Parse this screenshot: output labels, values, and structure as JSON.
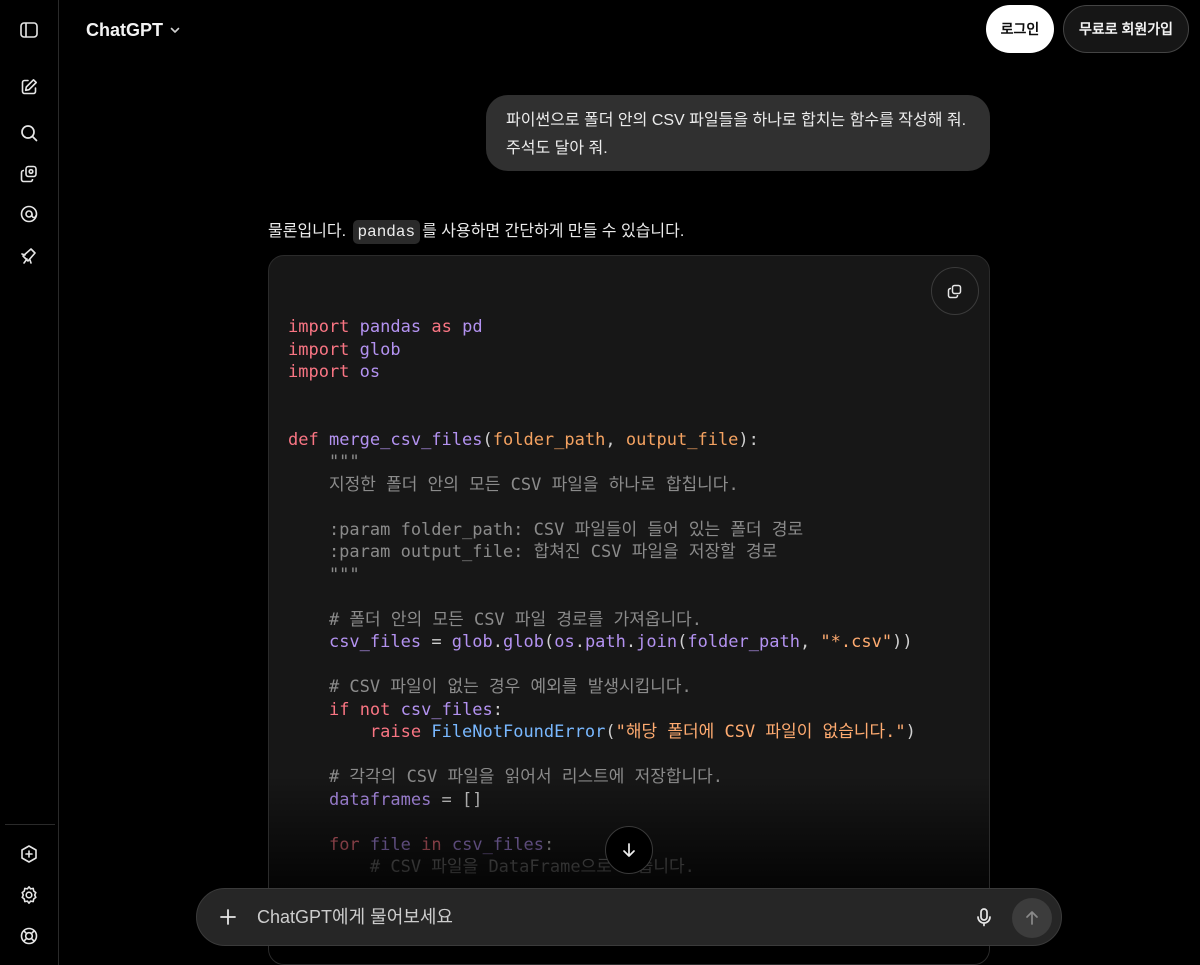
{
  "sidebar": {
    "icons": [
      "sidebar-toggle-icon",
      "new-chat-icon",
      "search-icon",
      "library-icon",
      "sora-icon",
      "gpts-icon",
      "upgrade-icon",
      "settings-icon",
      "help-icon"
    ]
  },
  "header": {
    "model_label": "ChatGPT",
    "login_label": "로그인",
    "signup_label": "무료로 회원가입"
  },
  "conversation": {
    "user_message": "파이썬으로 폴더 안의 CSV 파일들을 하나로 합치는 함수를 작성해 줘. 주석도 달아 줘.",
    "assistant_intro_before": "물론입니다.",
    "assistant_inline_code": "pandas",
    "assistant_intro_after": "를 사용하면 간단하게 만들 수 있습니다."
  },
  "code_block": {
    "lines": [
      "import pandas as pd",
      "import glob",
      "import os",
      "",
      "",
      "def merge_csv_files(folder_path, output_file):",
      "    \"\"\"",
      "    지정한 폴더 안의 모든 CSV 파일을 하나로 합칩니다.",
      "",
      "    :param folder_path: CSV 파일들이 들어 있는 폴더 경로",
      "    :param output_file: 합쳐진 CSV 파일을 저장할 경로",
      "    \"\"\"",
      "",
      "    # 폴더 안의 모든 CSV 파일 경로를 가져옵니다.",
      "    csv_files = glob.glob(os.path.join(folder_path, \"*.csv\"))",
      "",
      "    # CSV 파일이 없는 경우 예외를 발생시킵니다.",
      "    if not csv_files:",
      "        raise FileNotFoundError(\"해당 폴더에 CSV 파일이 없습니다.\")",
      "",
      "    # 각각의 CSV 파일을 읽어서 리스트에 저장합니다.",
      "    dataframes = []",
      "",
      "    for file in csv_files:",
      "        # CSV 파일을 DataFrame으로 읽습니다."
    ]
  },
  "composer": {
    "placeholder": "ChatGPT에게 물어보세요"
  },
  "colors": {
    "background": "#000000",
    "bubble": "#303030",
    "code_bg": "#171717",
    "keyword": "#f97583",
    "name": "#b392f0",
    "param": "#f4a261",
    "string": "#ffab70",
    "comment": "#8b8b8b",
    "builtin": "#79b8ff"
  }
}
